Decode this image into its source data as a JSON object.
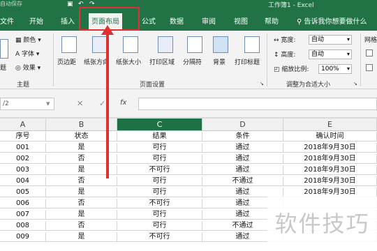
{
  "titlebar": {
    "autosave": "自动保存",
    "title": "工作簿1 - Excel",
    "undo_icon": "undo-icon",
    "redo_icon": "redo-icon",
    "save_icon": "save-icon"
  },
  "tabs": [
    "文件",
    "开始",
    "插入",
    "页面布局",
    "公式",
    "数据",
    "审阅",
    "视图",
    "帮助"
  ],
  "active_tab": "页面布局",
  "tellme": "告诉我你想要做什么",
  "ribbon": {
    "theme_group": {
      "label": "主题",
      "items": [
        "颜色",
        "字体",
        "效果"
      ],
      "partial_label": "题"
    },
    "page_setup_group": {
      "label": "页面设置",
      "buttons": [
        "页边距",
        "纸张方向",
        "纸张大小",
        "打印区域",
        "分隔符",
        "背景",
        "打印标题"
      ]
    },
    "scale_group": {
      "label": "调整为合适大小",
      "width_label": "宽度:",
      "width_value": "自动",
      "height_label": "高度:",
      "height_value": "自动",
      "scale_label": "缩放比例:",
      "scale_value": "100%"
    },
    "gridlines_partial": "网格"
  },
  "formula_bar": {
    "namebox": "/2",
    "fx": "fx"
  },
  "columns": [
    "A",
    "B",
    "C",
    "D",
    "E"
  ],
  "selected_column": "C",
  "headers": [
    "序号",
    "状态",
    "结果",
    "条件",
    "确认时间"
  ],
  "rows": [
    [
      "001",
      "是",
      "可行",
      "通过",
      "2018年9月30日"
    ],
    [
      "002",
      "否",
      "可行",
      "通过",
      "2018年9月30日"
    ],
    [
      "003",
      "是",
      "不可行",
      "通过",
      "2018年9月30日"
    ],
    [
      "004",
      "否",
      "可行",
      "不通过",
      "2018年9月30日"
    ],
    [
      "005",
      "是",
      "可行",
      "通过",
      "2018年9月30日"
    ],
    [
      "006",
      "否",
      "不可行",
      "通过",
      ""
    ],
    [
      "007",
      "是",
      "可行",
      "通过",
      ""
    ],
    [
      "008",
      "否",
      "可行",
      "不通过",
      ""
    ],
    [
      "009",
      "是",
      "不可行",
      "通过",
      ""
    ]
  ],
  "watermark": "软件技巧",
  "accent_color": "#217346",
  "annotation_color": "#e03030"
}
